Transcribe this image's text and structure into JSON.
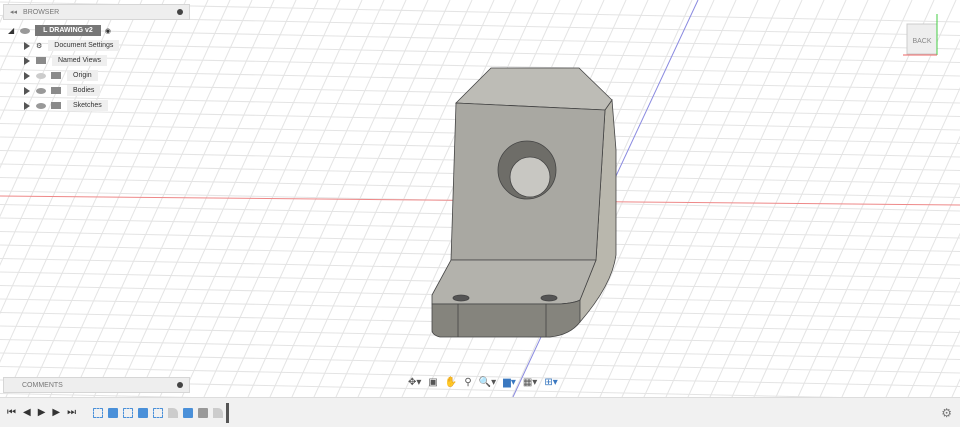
{
  "browser": {
    "title": "BROWSER",
    "root": "L DRAWING v2",
    "items": [
      {
        "label": "Document Settings",
        "icon": "gear-icon"
      },
      {
        "label": "Named Views",
        "icon": "folder-icon"
      },
      {
        "label": "Origin",
        "icon": "folder-icon"
      },
      {
        "label": "Bodies",
        "icon": "folder-icon"
      },
      {
        "label": "Sketches",
        "icon": "folder-icon"
      }
    ]
  },
  "comments": {
    "title": "COMMENTS"
  },
  "viewcube": {
    "face": "BACK"
  },
  "colors": {
    "x_axis": "#e05050",
    "y_axis": "#5a5ad8",
    "body": "#c9c8c2"
  }
}
